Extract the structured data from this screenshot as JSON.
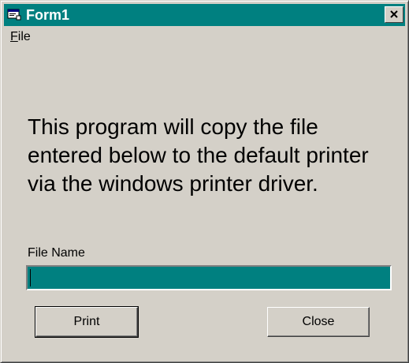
{
  "window": {
    "title": "Form1",
    "title_icon": "form-window-icon",
    "close_icon": "close-icon"
  },
  "menu": {
    "file_label_ul": "F",
    "file_label_rest": "ile"
  },
  "main": {
    "description": "This program will copy the file entered below to the default printer via the windows printer driver.",
    "file_name_label": "File Name",
    "file_name_value": ""
  },
  "buttons": {
    "print_label": "Print",
    "close_label": "Close"
  },
  "colors": {
    "titlebar": "#008080",
    "window_face": "#d4d0c8",
    "input_background": "#008080"
  }
}
